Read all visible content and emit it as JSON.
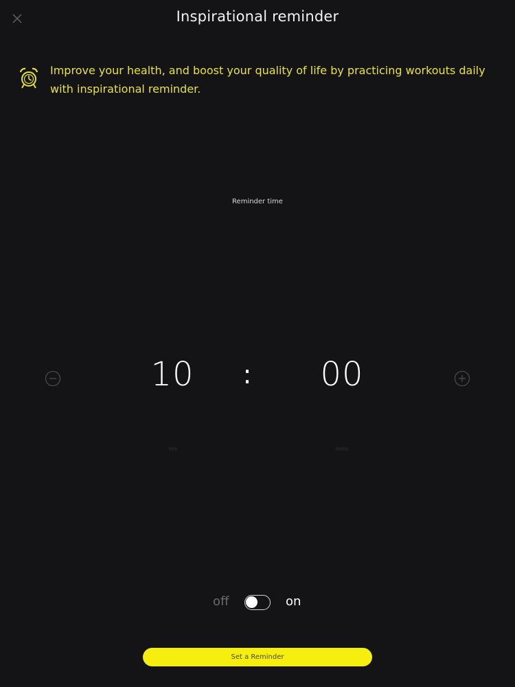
{
  "header": {
    "title": "Inspirational reminder"
  },
  "intro": {
    "text": "Improve your health, and boost your quality of life by practicing workouts daily with inspirational reminder.",
    "icon": "alarm-clock-icon",
    "accent_color": "#e7e339"
  },
  "reminder": {
    "label": "Reminder time",
    "hours": "10",
    "separator": ":",
    "minutes": "00",
    "hours_unit": "hrs",
    "minutes_unit": "mins"
  },
  "toggle": {
    "off_label": "off",
    "on_label": "on",
    "state": false
  },
  "actions": {
    "set_label": "Set a Reminder",
    "button_color": "#f6ee0e"
  }
}
